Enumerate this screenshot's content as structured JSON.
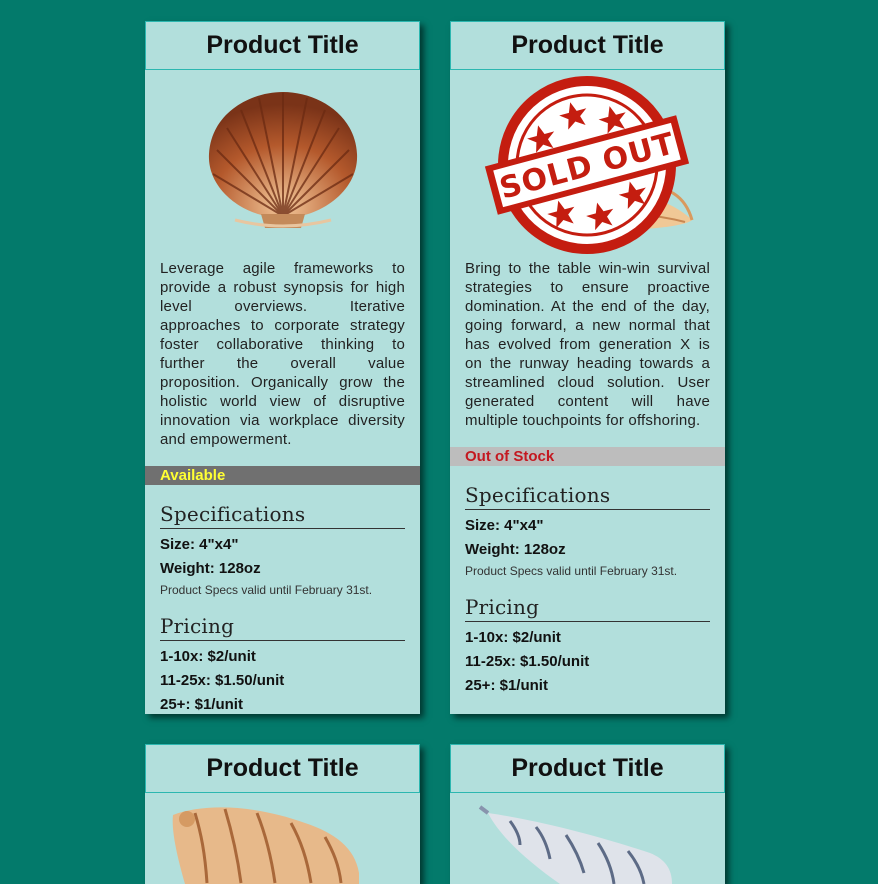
{
  "products": [
    {
      "title": "Product Title",
      "description": "Leverage agile frameworks to provide a robust synopsis for high level overviews. Iterative approaches to corporate strategy foster collaborative thinking to further the overall value proposition. Organically grow the holistic world view of disruptive innovation via workplace diversity and empowerment.",
      "status": "Available",
      "specs_heading": "Specifications",
      "size": "Size: 4\"x4\"",
      "weight": "Weight: 128oz",
      "specs_note": "Product Specs valid until February 31st.",
      "pricing_heading": "Pricing",
      "prices": [
        "1-10x: $2/unit",
        "11-25x: $1.50/unit",
        "25+: $1/unit"
      ]
    },
    {
      "title": "Product Title",
      "description": "Bring to the table win-win survival strategies to ensure proactive domination. At the end of the day, going forward, a new normal that has evolved from generation X is on the runway heading towards a streamlined cloud solution. User generated content will have multiple touchpoints for offshoring.",
      "status": "Out of Stock",
      "stamp_text": "SOLD OUT",
      "specs_heading": "Specifications",
      "size": "Size: 4\"x4\"",
      "weight": "Weight: 128oz",
      "specs_note": "Product Specs valid until February 31st.",
      "pricing_heading": "Pricing",
      "prices": [
        "1-10x: $2/unit",
        "11-25x: $1.50/unit",
        "25+: $1/unit"
      ]
    },
    {
      "title": "Product Title"
    },
    {
      "title": "Product Title"
    }
  ],
  "colors": {
    "background": "#037a6b",
    "card": "#b2dfdc",
    "available_text": "#ffff33",
    "out_of_stock_text": "#c41820"
  }
}
